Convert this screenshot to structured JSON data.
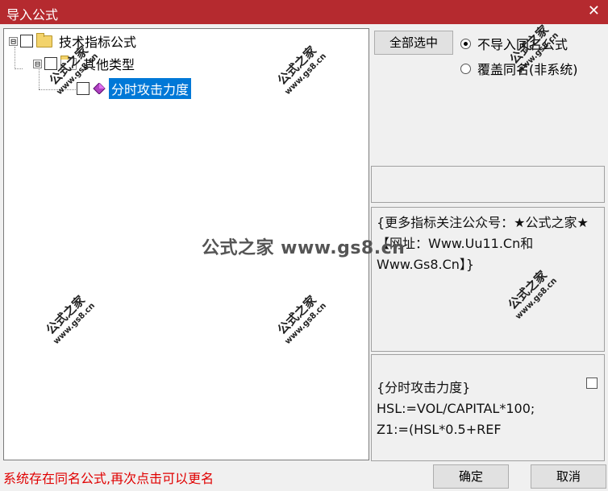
{
  "window": {
    "title": "导入公式",
    "close_glyph": "✕"
  },
  "tree": {
    "root": {
      "label": "技术指标公式",
      "expander": "⊟"
    },
    "child": {
      "label": "其他类型",
      "expander": "⊟"
    },
    "leaf": {
      "label": "分时攻击力度",
      "icon": "purple-diamond-icon",
      "selected": true
    }
  },
  "toolbar": {
    "select_all_label": "全部选中"
  },
  "options": [
    {
      "label": "不导入同名公式",
      "checked": true
    },
    {
      "label": "覆盖同名(非系统)",
      "checked": false
    }
  ],
  "description": {
    "text": "{更多指标关注公众号：★公式之家★ 【网址：Www.Uu11.Cn和Www.Gs8.Cn】}"
  },
  "code": {
    "lines": [
      "{分时攻击力度}",
      "HSL:=VOL/CAPITAL*100;",
      "Z1:=(HSL*0.5+REF"
    ]
  },
  "status_text": "系统存在同名公式,再次点击可以更名",
  "buttons": {
    "ok_label": "确定",
    "cancel_label": "取消"
  },
  "watermark": {
    "text": "公式之家",
    "url": "www.gs8.cn",
    "center_text": "公式之家 www.gs8.cn"
  },
  "colors": {
    "titlebar": "#b52a2f",
    "selection": "#0078d7",
    "status": "#e00000"
  }
}
